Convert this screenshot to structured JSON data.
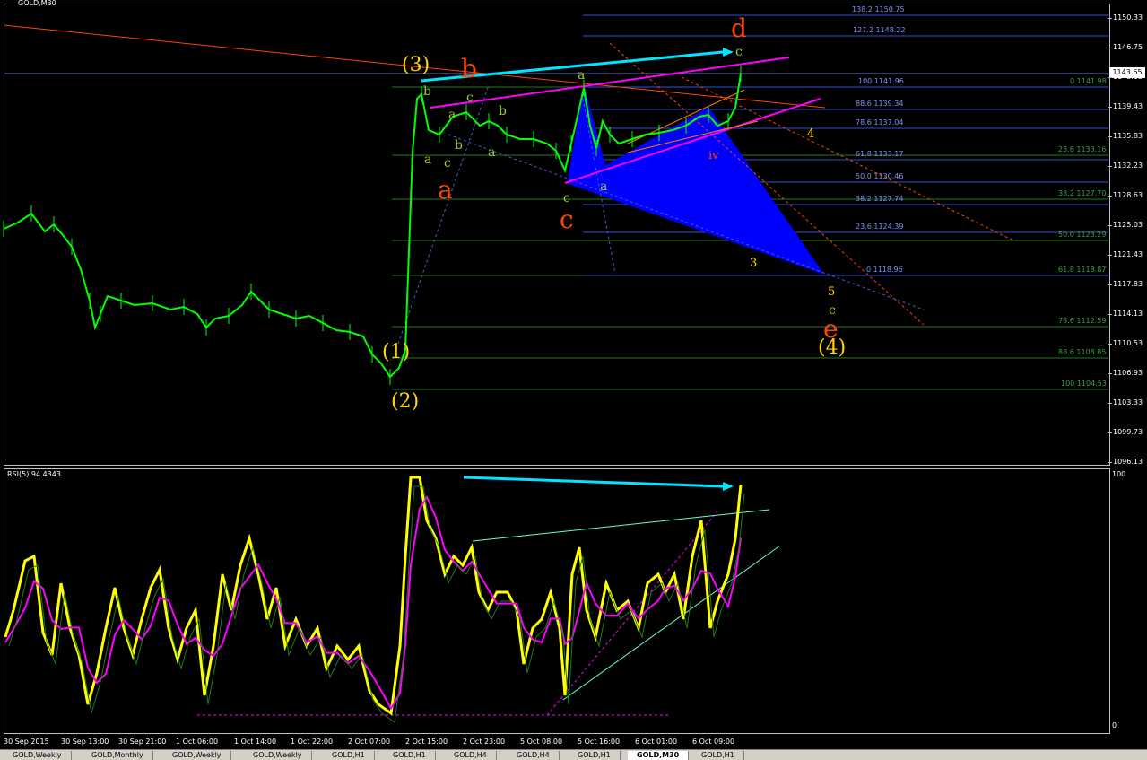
{
  "symbol_label": "GOLD,M30",
  "rsi_label": "RSI(5) 94.4343",
  "current_price": "1143.65",
  "price_axis": [
    "1150.33",
    "1146.75",
    "1143.15",
    "1139.43",
    "1135.83",
    "1132.23",
    "1128.63",
    "1125.03",
    "1121.43",
    "1117.83",
    "1114.13",
    "1110.53",
    "1106.93",
    "1103.33",
    "1099.73",
    "1096.13"
  ],
  "rsi_axis": [
    "100",
    "0"
  ],
  "time_axis": [
    "30 Sep 2015",
    "30 Sep 13:00",
    "30 Sep 21:00",
    "1 Oct 06:00",
    "1 Oct 14:00",
    "1 Oct 22:00",
    "2 Oct 07:00",
    "2 Oct 15:00",
    "2 Oct 23:00",
    "5 Oct 08:00",
    "5 Oct 16:00",
    "6 Oct 01:00",
    "6 Oct 09:00"
  ],
  "fib_blue": [
    "138.2 1150.75",
    "127.2 1148.22",
    "100 1141.96",
    "88.6 1139.34",
    "78.6 1137.04",
    "61.8 1133.17",
    "50.0 1130.46",
    "38.2 1127.74",
    "23.6 1124.39",
    "0 1118.96"
  ],
  "fib_green": [
    "0 1141.98",
    "23.6 1133.16",
    "38.2 1127.70",
    "50.0 1123.29",
    "61.8 1118.87",
    "78.6 1112.59",
    "88.6 1108.85",
    "100 1104.53"
  ],
  "wave_labels": {
    "w1": "(1)",
    "w2": "(2)",
    "w3": "(3)",
    "w4": "(4)",
    "red_a": "a",
    "red_b": "b",
    "red_c": "c",
    "red_d": "d",
    "red_e": "e",
    "sub_a": "a",
    "sub_b": "b",
    "sub_c": "c",
    "y3": "3",
    "y4": "4",
    "y5": "5",
    "iv": "iv"
  },
  "tabs": [
    "GOLD,Weekly",
    "GOLD,Monthly",
    "GOLD,Weekly",
    "GOLD,Weekly",
    "GOLD,H1",
    "GOLD,H1",
    "GOLD,H4",
    "GOLD,H4",
    "GOLD,H1",
    "GOLD,M30",
    "GOLD,H1"
  ],
  "active_tab_index": 9,
  "colors": {
    "candles": "#00ff00",
    "rsi": "#ffff00",
    "ma": "#ff00ff",
    "cyan": "#00e5ff",
    "pattern": "#0000ff",
    "orange": "#ff4500",
    "gold": "#ffd700"
  }
}
